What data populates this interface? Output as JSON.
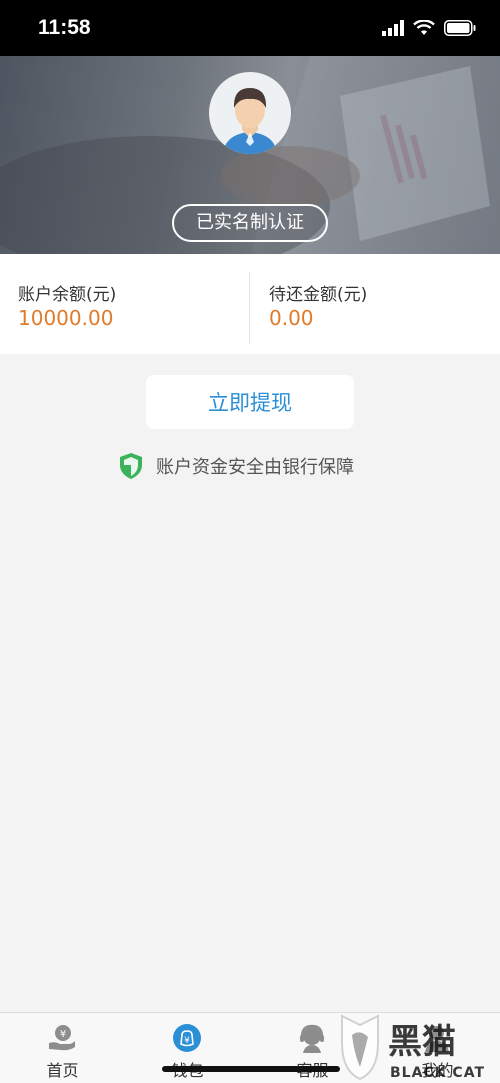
{
  "status_bar": {
    "time": "11:58"
  },
  "header": {
    "verify_badge": "已实名制认证"
  },
  "balance": {
    "account_balance_label": "账户余额(元)",
    "account_balance_value": "10000.00",
    "pending_repay_label": "待还金额(元)",
    "pending_repay_value": "0.00"
  },
  "actions": {
    "withdraw_label": "立即提现"
  },
  "security": {
    "note": "账户资金安全由银行保障"
  },
  "tabs": [
    {
      "label": "首页",
      "icon": "home-money-icon",
      "active": false
    },
    {
      "label": "钱包",
      "icon": "wallet-icon",
      "active": true
    },
    {
      "label": "客服",
      "icon": "customer-service-icon",
      "active": false
    },
    {
      "label": "我的",
      "icon": "profile-icon",
      "active": false
    }
  ],
  "watermark": {
    "cn": "黑猫",
    "en": "BLACK CAT"
  },
  "colors": {
    "accent_blue": "#2b8fd6",
    "amount_orange": "#e07b2a",
    "shield_green": "#3cb35a"
  }
}
